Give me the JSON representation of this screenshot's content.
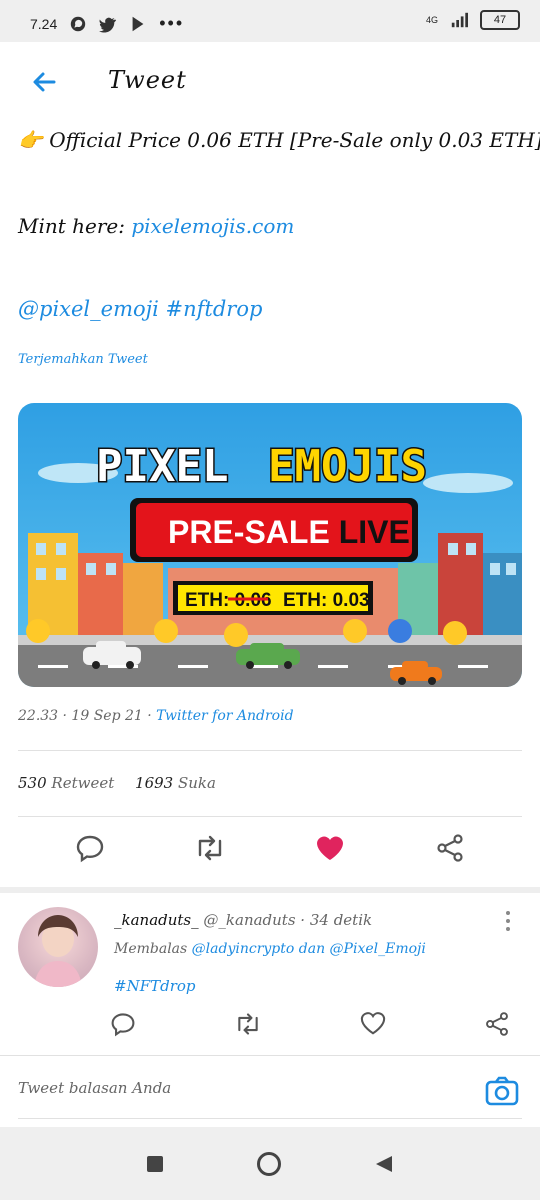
{
  "status_bar": {
    "time": "7.24",
    "battery": "47",
    "signal_label": "4G"
  },
  "header": {
    "title": "Tweet"
  },
  "tweet": {
    "price_line": "👉 Official Price 0.06 ETH [Pre-Sale only 0.03 ETH]",
    "mint_prefix": "Mint here: ",
    "mint_link": "pixelemojis.com",
    "tags": "@pixel_emoji #nftdrop",
    "translate": "Terjemahkan Tweet",
    "banner": {
      "brand_1": "PIXEL",
      "brand_2": "EMOJIS",
      "presale_1": "PRE-SALE ",
      "presale_2": "LIVE",
      "eth_old": "ETH: 0.06",
      "eth_new": "ETH: 0.03"
    },
    "meta_time": "22.33 · 19 Sep 21 · ",
    "meta_via": "Twitter for Android",
    "retweets": "530",
    "retweets_label": "Retweet",
    "likes": "1693",
    "likes_label": "Suka"
  },
  "reply": {
    "name": "_kanaduts_",
    "handle": "@_kanaduts · 34 detik",
    "replying_prefix": "Membalas ",
    "replying_to": "@ladyincrypto dan @Pixel_Emoji",
    "tag": "#NFTdrop"
  },
  "compose": {
    "placeholder": "Tweet balasan Anda"
  },
  "colors": {
    "accent": "#1d8be0",
    "like": "#e0245e"
  }
}
